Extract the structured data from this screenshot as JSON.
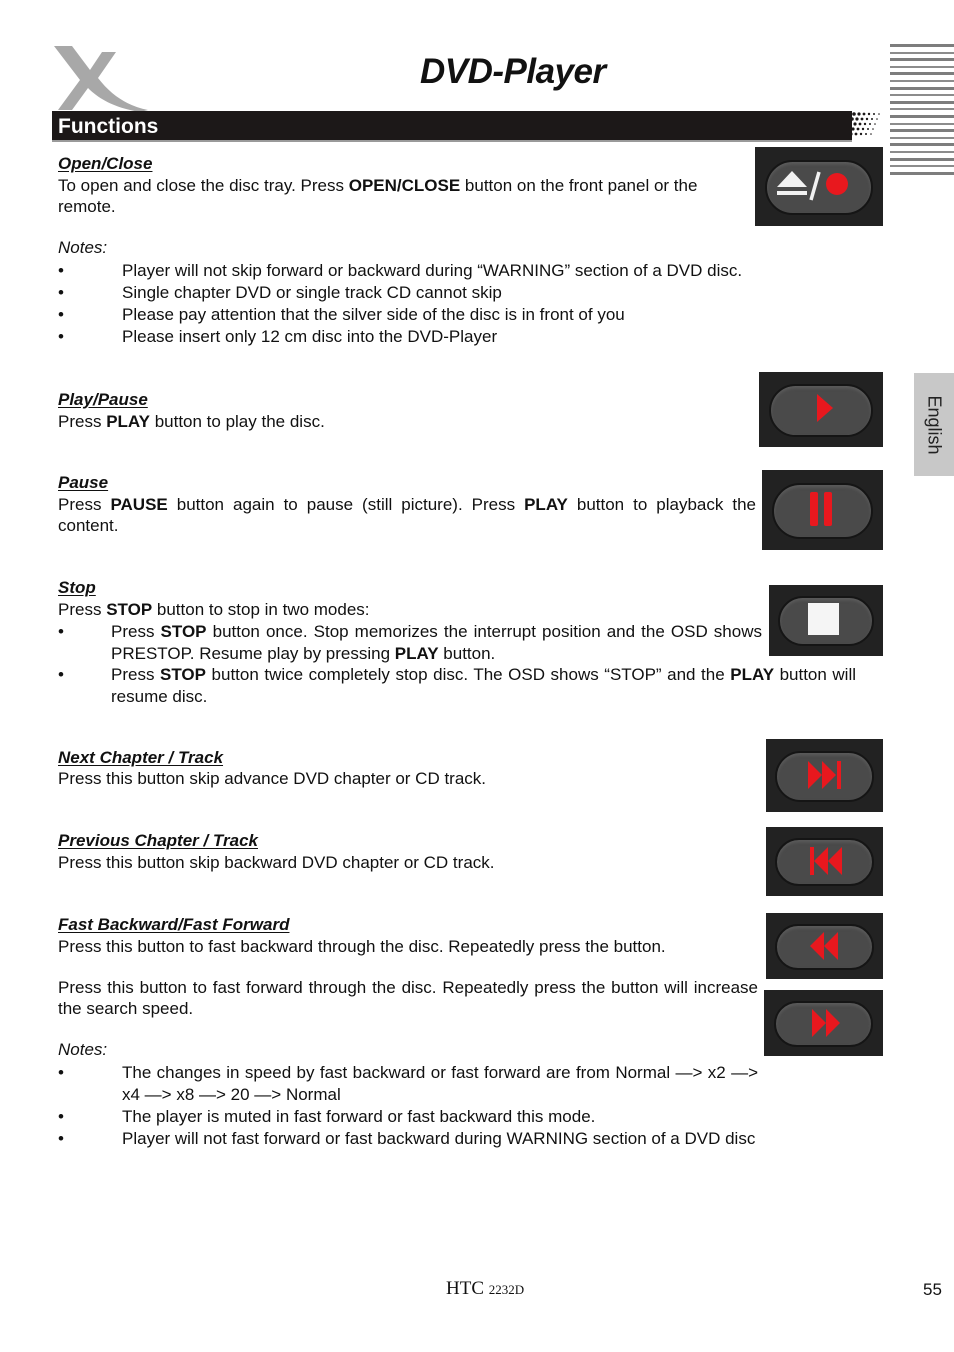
{
  "header": {
    "title": "DVD-Player",
    "section": "Functions",
    "language_tab": "English",
    "logo": "x-brand-logo"
  },
  "sections": {
    "open_close": {
      "heading": "Open/Close",
      "text_pre": "To open and close the disc tray. Press ",
      "text_bold": "OPEN/CLOSE",
      "text_post": " button on the front panel or the remote.",
      "icon": "eject-record-button-icon",
      "notes_label": "Notes:",
      "notes": [
        "Player will not skip forward or backward during “WARNING” section of a DVD disc.",
        "Single chapter DVD or single track CD cannot skip",
        "Please pay attention that the silver side of the disc is in front of you",
        "Please insert only 12 cm disc into the DVD-Player"
      ]
    },
    "play_pause": {
      "heading": "Play/Pause",
      "text_pre": "Press ",
      "text_bold": "PLAY",
      "text_post": " button to play the disc.",
      "icon": "play-button-icon"
    },
    "pause": {
      "heading": "Pause",
      "text_1": "Press ",
      "bold_1": "PAUSE",
      "text_2": " button again to pause (still picture). Press ",
      "bold_2": "PLAY",
      "text_3": " button to playback the content.",
      "icon": "pause-button-icon"
    },
    "stop": {
      "heading": "Stop",
      "text_pre": "Press ",
      "text_bold": "STOP",
      "text_post": " button to stop in two modes:",
      "icon": "stop-button-icon",
      "bullets": [
        {
          "a": "Press ",
          "b": "STOP",
          "c": " button once. Stop memorizes the  interrupt  position and the OSD shows PRESTOP. Resume play by pressing ",
          "d": "PLAY",
          "e": " button."
        },
        {
          "a": "Press ",
          "b": "STOP",
          "c": " button twice completely stop disc. The OSD shows “STOP” and the ",
          "d": "PLAY",
          "e": " button will resume disc."
        }
      ]
    },
    "next": {
      "heading": "Next Chapter / Track",
      "text": "Press this button skip advance DVD chapter or CD track.",
      "icon": "next-track-button-icon"
    },
    "previous": {
      "heading": "Previous Chapter / Track",
      "text": "Press this button skip backward DVD chapter or CD track.",
      "icon": "previous-track-button-icon"
    },
    "fast": {
      "heading": "Fast Backward/Fast Forward",
      "text_back": "Press this button to fast backward through the disc. Repeatedly press the button.",
      "text_fwd": "Press this button to fast forward through the disc. Repeatedly press the button will increase the search speed.",
      "icon_back": "fast-backward-button-icon",
      "icon_fwd": "fast-forward-button-icon",
      "notes_label": "Notes:",
      "notes": [
        "The changes in speed by fast backward or fast forward are from Normal —> x2 —> x4 —> x8 —> 20 —> Normal",
        "The player is muted in fast forward or fast backward this mode.",
        "Player will not fast forward or fast backward during WARNING section of a DVD disc"
      ]
    }
  },
  "footer": {
    "model_prefix": "HTC ",
    "model_number": "2232D",
    "page_number": "55"
  },
  "colors": {
    "section_bar": "#1c1818",
    "button_body": "#4a4a4a",
    "button_glyph_red": "#e8181e",
    "language_tab": "#c8c8c8"
  }
}
